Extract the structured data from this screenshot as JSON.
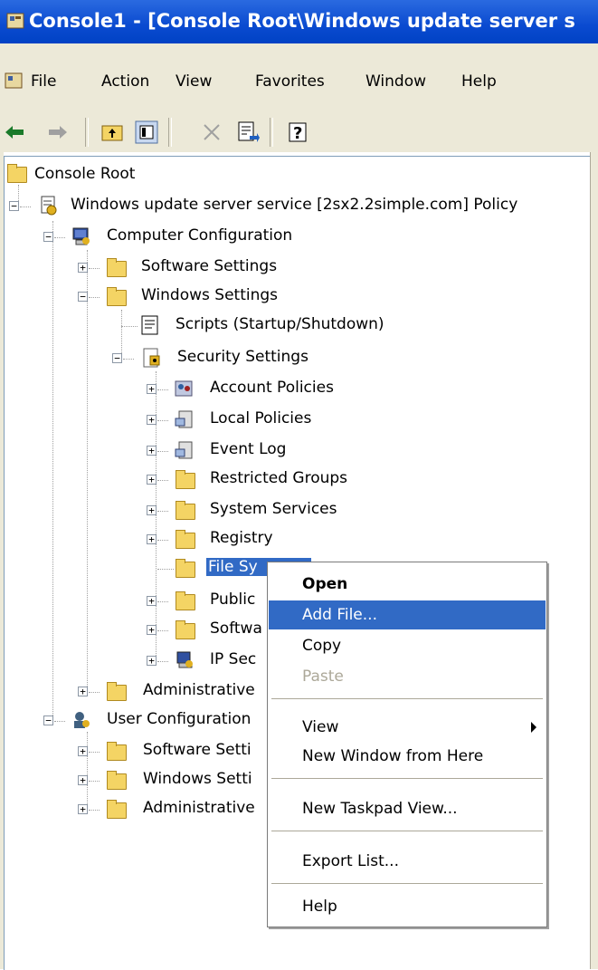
{
  "window": {
    "title": "Console1 - [Console Root\\Windows update server s"
  },
  "menu": {
    "items": [
      "File",
      "Action",
      "View",
      "Favorites",
      "Window",
      "Help"
    ]
  },
  "toolbar": {
    "buttons": [
      "back-icon",
      "forward-icon",
      "up-level-icon",
      "show-hide-tree-icon",
      "delete-icon",
      "export-list-icon",
      "help-icon"
    ]
  },
  "tree": {
    "root": "Console Root",
    "policy": "Windows update server service [2sx2.2simple.com] Policy",
    "computer_config": "Computer Configuration",
    "software_settings": "Software Settings",
    "windows_settings": "Windows Settings",
    "scripts": "Scripts (Startup/Shutdown)",
    "security_settings": "Security Settings",
    "account_policies": "Account Policies",
    "local_policies": "Local Policies",
    "event_log": "Event Log",
    "restricted_groups": "Restricted Groups",
    "system_services": "System Services",
    "registry": "Registry",
    "file_system": "File Sy",
    "public_key": "Public",
    "software_restriction": "Softwa",
    "ip_security": "IP Sec",
    "administrative_templates": "Administrative",
    "user_config": "User Configuration",
    "user_software_settings": "Software Setti",
    "user_windows_settings": "Windows Setti",
    "user_administrative": "Administrative"
  },
  "context_menu": {
    "open": "Open",
    "add_file": "Add File...",
    "copy": "Copy",
    "paste": "Paste",
    "view": "View",
    "new_window": "New Window from Here",
    "new_taskpad": "New Taskpad View...",
    "export_list": "Export List...",
    "help": "Help"
  },
  "colors": {
    "selection": "#316ac5",
    "titlebar": "#0a4ad0",
    "folder": "#f4d464"
  }
}
